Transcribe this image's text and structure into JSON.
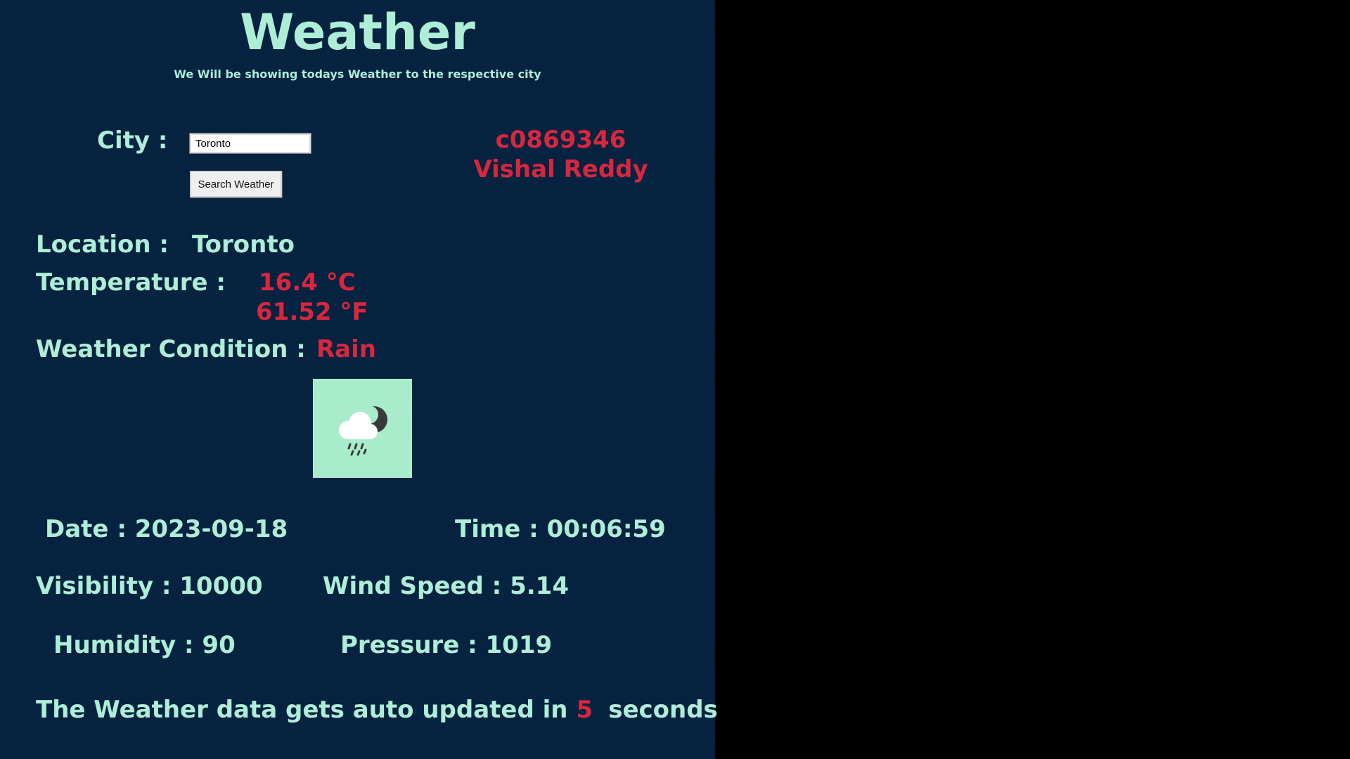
{
  "header": {
    "title": "Weather",
    "subtitle": "We Will be showing todays Weather to the respective city"
  },
  "search": {
    "city_label": "City :",
    "city_value": "Toronto",
    "button_label": "Search Weather"
  },
  "student": {
    "id": "c0869346",
    "name": "Vishal Reddy"
  },
  "weather": {
    "location_label": "Location :",
    "location_value": "Toronto",
    "temperature_label": "Temperature :",
    "temperature_c": "16.4 °C",
    "temperature_f": "61.52 °F",
    "condition_label": "Weather Condition :",
    "condition_value": "Rain",
    "icon": "rain-cloud-moon-icon"
  },
  "details": {
    "date": "Date : 2023-09-18",
    "time": "Time : 00:06:59",
    "visibility": "Visibility : 10000",
    "wind_speed": "Wind Speed : 5.14",
    "humidity": "Humidity : 90",
    "pressure": "Pressure : 1019"
  },
  "footer": {
    "auto_update_prefix": "The Weather data gets auto updated in",
    "auto_update_seconds": "5",
    "auto_update_suffix": "seconds"
  },
  "colors": {
    "panel_background": "#04213f",
    "text_mint": "#aeeed7",
    "text_red": "#d7273f",
    "icon_background": "#a8eccb",
    "outside_background": "#000000"
  }
}
